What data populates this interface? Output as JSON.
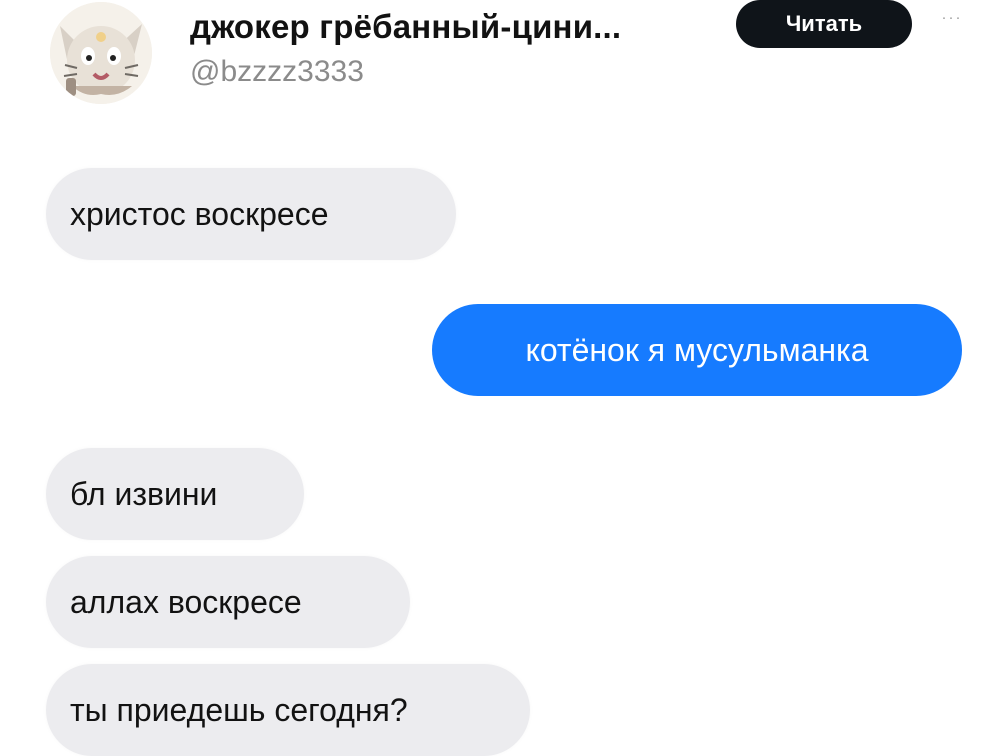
{
  "header": {
    "display_name": "джокер грёбанный-цини...",
    "handle": "@bzzzz3333",
    "follow_label": "Читать",
    "more_label": "···"
  },
  "messages": [
    {
      "text": "христос воскресе",
      "direction": "incoming"
    },
    {
      "text": "котёнок я мусульманка",
      "direction": "outgoing"
    },
    {
      "text": "бл извини",
      "direction": "incoming"
    },
    {
      "text": "аллах воскресе",
      "direction": "incoming"
    },
    {
      "text": "ты приедешь сегодня?",
      "direction": "incoming"
    }
  ],
  "colors": {
    "outgoing_bubble": "#167bff",
    "incoming_bubble": "#ececef",
    "follow_button": "#0f1419",
    "handle_text": "#8b8b8b"
  },
  "icons": {
    "avatar": "cartoon-cat-avatar-icon",
    "more": "more-options-icon"
  }
}
